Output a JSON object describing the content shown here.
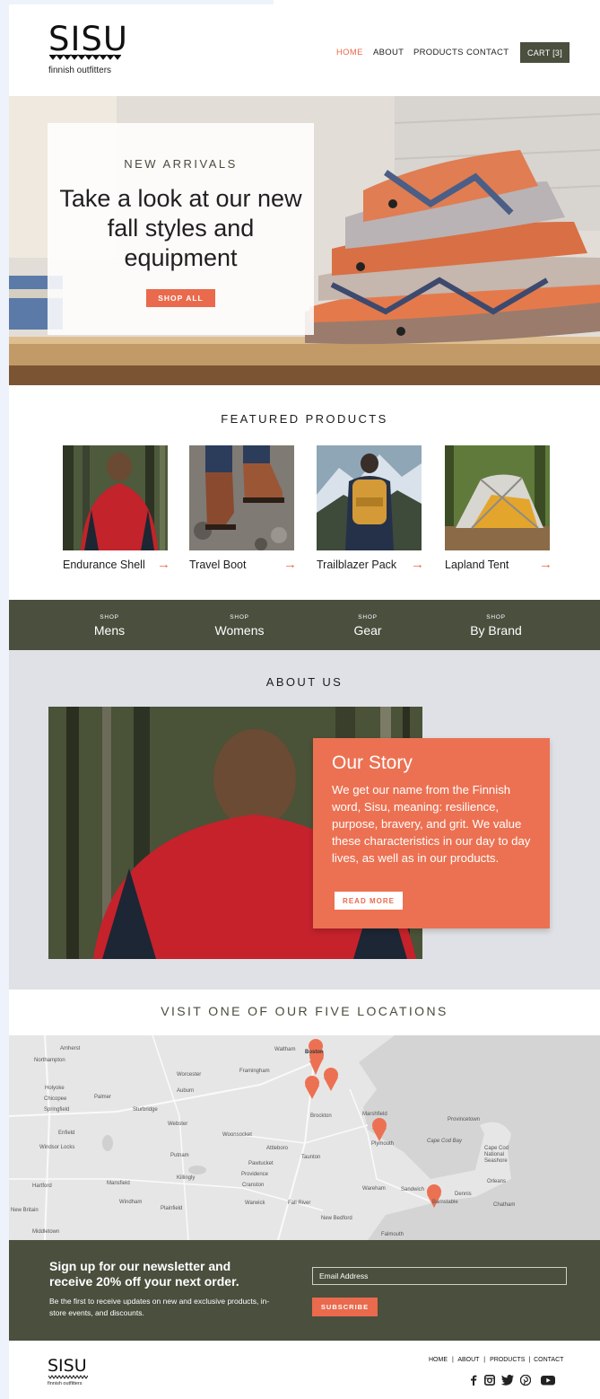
{
  "brand": {
    "name": "SISU",
    "tagline": "finnish outfitters"
  },
  "nav": {
    "items": [
      {
        "label": "HOME",
        "active": true
      },
      {
        "label": "ABOUT"
      },
      {
        "label": "PRODUCTS"
      },
      {
        "label": "CONTACT"
      }
    ],
    "cart_label": "CART [3]"
  },
  "hero": {
    "eyebrow": "NEW ARRIVALS",
    "title": "Take a look at our new fall styles and equipment",
    "button": "SHOP ALL"
  },
  "featured": {
    "title": "FEATURED PRODUCTS",
    "products": [
      {
        "name": "Endurance Shell",
        "arrow": "→"
      },
      {
        "name": "Travel Boot",
        "arrow": "→"
      },
      {
        "name": "Trailblazer Pack",
        "arrow": "→"
      },
      {
        "name": "Lapland Tent",
        "arrow": "→"
      }
    ]
  },
  "shop_bar": {
    "prefix": "SHOP",
    "categories": [
      "Mens",
      "Womens",
      "Gear",
      "By Brand"
    ]
  },
  "about": {
    "title": "ABOUT US",
    "story_heading": "Our Story",
    "story_text": "We get our name from the Finnish word, Sisu, meaning: resilience, purpose, bravery, and grit. We value these characteristics in our day to day lives, as well as in our products.",
    "button": "READ MORE"
  },
  "locations": {
    "title": "VISIT ONE OF OUR FIVE LOCATIONS",
    "map_labels": [
      "Amherst",
      "Northampton",
      "Holyoke",
      "Chicopee",
      "Springfield",
      "Enfield",
      "Windsor Locks",
      "Hartford",
      "New Britain",
      "Middletown",
      "Palmer",
      "Sturbridge",
      "Webster",
      "Putnam",
      "Killingly",
      "Windham",
      "Plainfield",
      "Mansfield",
      "Worcester",
      "Auburn",
      "Framingham",
      "Waltham",
      "Boston",
      "Woonsocket",
      "Attleboro",
      "Pawtucket",
      "Providence",
      "Cranston",
      "Warwick",
      "Fall River",
      "New Bedford",
      "Taunton",
      "Brockton",
      "Marshfield",
      "Plymouth",
      "Wareham",
      "Sandwich",
      "Barnstable",
      "Dennis",
      "Chatham",
      "Orleans",
      "Provincetown",
      "Cape Cod National Seashore",
      "Cape Cod Bay",
      "Falmouth"
    ],
    "pin_count": 5
  },
  "newsletter": {
    "heading": "Sign up for our newsletter and receive 20% off your next order.",
    "text": "Be the first to receive updates on new and exclusive products, in-store events, and discounts.",
    "email_placeholder": "Email Address",
    "button": "SUBSCRIBE"
  },
  "footer": {
    "brand": "SISU",
    "tagline": "finnish outfitters",
    "links": [
      "HOME",
      "ABOUT",
      "PRODUCTS",
      "CONTACT"
    ],
    "separator": "|",
    "social": [
      "facebook-icon",
      "instagram-icon",
      "twitter-icon",
      "pinterest-icon",
      "youtube-icon"
    ]
  },
  "colors": {
    "accent": "#e96a4c",
    "olive": "#4a4f3e",
    "about_bg": "#dfe1e6"
  }
}
